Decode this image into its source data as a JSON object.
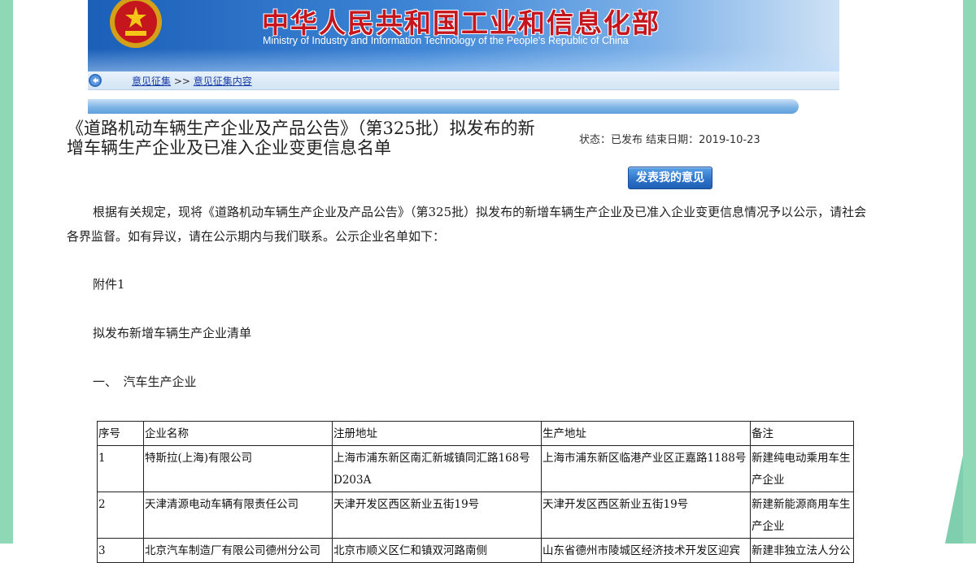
{
  "banner": {
    "title": "中华人民共和国工业和信息化部",
    "subtitle": "Ministry of Industry and Information Technology of the People's Republic of China"
  },
  "breadcrumb": {
    "link1": "意见征集",
    "separator": ">>",
    "link2": "意见征集内容"
  },
  "article": {
    "title": "《道路机动车辆生产企业及产品公告》（第325批）拟发布的新增车辆生产企业及已准入企业变更信息名单",
    "status": "状态：已发布 结束日期：2019-10-23",
    "opinion_button": "发表我的意见",
    "intro": "根据有关规定，现将《道路机动车辆生产企业及产品公告》（第325批）拟发布的新增车辆生产企业及已准入企业变更信息情况予以公示，请社会各界监督。如有异议，请在公示期内与我们联系。公示企业名单如下：",
    "attachment": "附件1",
    "list_title": "拟发布新增车辆生产企业清单",
    "section": "一、　汽车生产企业"
  },
  "table": {
    "headers": [
      "序号",
      "企业名称",
      "注册地址",
      "生产地址",
      "备注"
    ],
    "rows": [
      [
        "1",
        "特斯拉(上海)有限公司",
        "上海市浦东新区南汇新城镇同汇路168号D203A",
        "上海市浦东新区临港产业区正嘉路1188号",
        "新建纯电动乘用车生产企业"
      ],
      [
        "2",
        "天津清源电动车辆有限责任公司",
        "天津开发区西区新业五街19号",
        "天津开发区西区新业五街19号",
        "新建新能源商用车生产企业"
      ],
      [
        "3",
        "北京汽车制造厂有限公司德州分公司",
        "北京市顺义区仁和镇双河路南侧",
        "山东省德州市陵城区经济技术开发区迎宾",
        "新建非独立法人分公"
      ]
    ]
  },
  "colors": {
    "side": "#8fd8b6",
    "banner_title": "#c4161c",
    "link": "#1a3da6",
    "button": "#2c72c9"
  }
}
